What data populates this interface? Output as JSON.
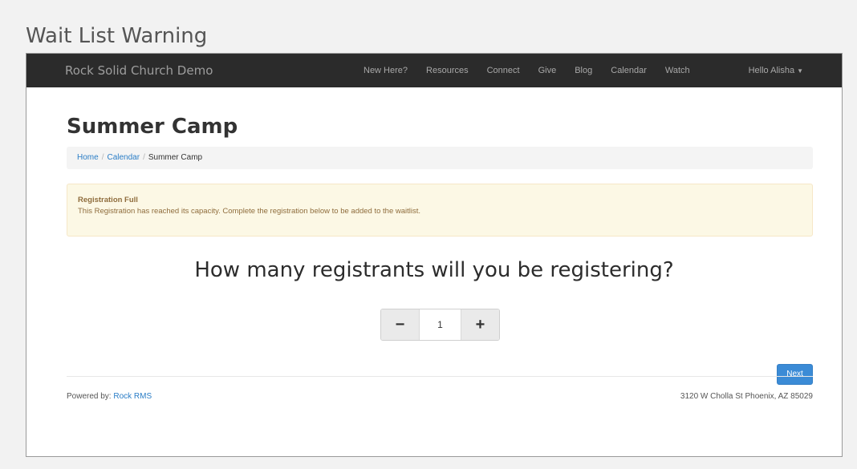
{
  "outer_title": "Wait List Warning",
  "navbar": {
    "brand": "Rock Solid Church Demo",
    "links": [
      "New Here?",
      "Resources",
      "Connect",
      "Give",
      "Blog",
      "Calendar",
      "Watch"
    ],
    "user": "Hello Alisha"
  },
  "page": {
    "title": "Summer Camp",
    "breadcrumb": {
      "home": "Home",
      "sep": "/",
      "calendar": "Calendar",
      "current": "Summer Camp"
    },
    "alert": {
      "title": "Registration Full",
      "message": "This Registration has reached its capacity. Complete the registration below to be added to the waitlist."
    },
    "question": "How many registrants will you be registering?",
    "stepper": {
      "minus": "−",
      "value": "1",
      "plus": "+"
    },
    "next_label": "Next"
  },
  "footer": {
    "powered_by": "Powered by:",
    "powered_link": "Rock RMS",
    "address": "3120 W Cholla St Phoenix, AZ 85029"
  },
  "colors": {
    "navbar_bg": "#2b2b2b",
    "link": "#2a7dc6",
    "alert_bg": "#fcf8e5",
    "alert_text": "#8f6d3d",
    "primary_button": "#3b8bd6"
  },
  "icons": {
    "user_menu_caret": "chevron-down-icon"
  }
}
